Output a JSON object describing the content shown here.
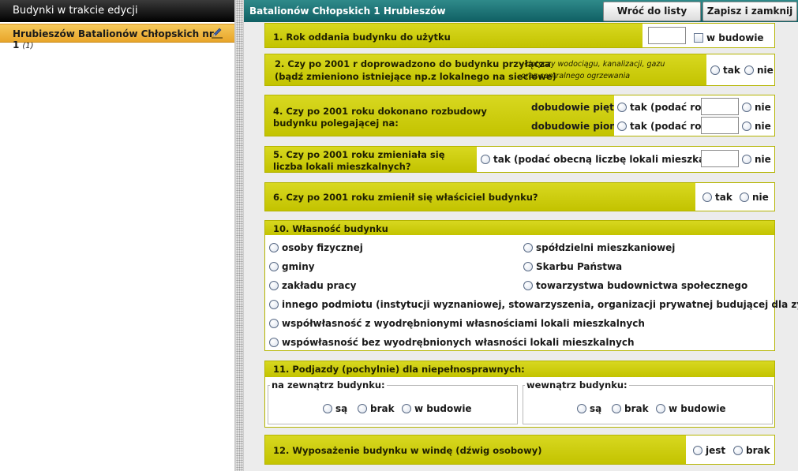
{
  "left_panel": {
    "header": "Budynki w trakcie edycji",
    "items": [
      {
        "label": "Hrubieszów Batalionów Chłopskich nr 1",
        "count": "(1)",
        "icon": "edit-pencil-icon"
      }
    ]
  },
  "header": {
    "title": "Batalionów Chłopskich 1  Hrubieszów",
    "back_button": "Wróć do listy",
    "save_button": "Zapisz i zamknij"
  },
  "s1": {
    "question": "1. Rok oddania budynku do użytku",
    "year_value": "",
    "checkbox_label": "w budowie"
  },
  "s2": {
    "question_line1": "2. Czy po 2001 r doprowadzono do budynku przyłącza",
    "question_line2": "(bądź zmieniono istniejące np.z lokalnego na sieciowe)",
    "note_line1": "- dotyczy wodociągu, kanalizacji, gazu",
    "note_line2": "oraz centralnego ogrzewania",
    "opt_yes": "tak",
    "opt_no": "nie"
  },
  "s4": {
    "question_line1": "4. Czy po 2001 roku dokonano rozbudowy",
    "question_line2": "budynku polegającej na:",
    "row1_label": "dobudowie piętra",
    "row2_label": "dobudowie pionu",
    "opt_yes": "tak (podać rok)",
    "opt_no": "nie",
    "row1_value": "",
    "row2_value": ""
  },
  "s5": {
    "question_line1": "5. Czy po 2001 roku zmieniała się",
    "question_line2": "liczba lokali mieszkalnych?",
    "opt_yes": "tak (podać obecną liczbę lokali mieszkalnych)",
    "opt_no": "nie",
    "value": ""
  },
  "s6": {
    "question": "6. Czy po 2001 roku zmienił się właściciel budynku?",
    "opt_yes": "tak",
    "opt_no": "nie"
  },
  "s10": {
    "title": "10. Własność budynku",
    "options": [
      "osoby fizycznej",
      "spółdzielni mieszkaniowej",
      "gminy",
      "Skarbu Państwa",
      "zakładu pracy",
      "towarzystwa budownictwa społecznego",
      "innego podmiotu (instytucji wyznaniowej, stowarzyszenia, organizacji prywatnej budującej dla zysku )",
      "współwłasność z wyodrębnionymi własnościami lokali mieszkalnych",
      "wspówłasność bez wyodrębnionych własności lokali mieszkalnych"
    ]
  },
  "s11": {
    "title": "11. Podjazdy (pochylnie) dla niepełnosprawnych:",
    "outside_label": "na zewnątrz budynku:",
    "inside_label": "wewnątrz budynku:",
    "opt_yes": "są",
    "opt_no": "brak",
    "opt_building": "w budowie"
  },
  "s12": {
    "question": "12. Wyposażenie budynku w windę (dźwig osobowy)",
    "opt_yes": "jest",
    "opt_no": "brak"
  },
  "colors": {
    "olive": "#c8c800",
    "teal": "#0f5f63",
    "orange": "#eab13a"
  }
}
